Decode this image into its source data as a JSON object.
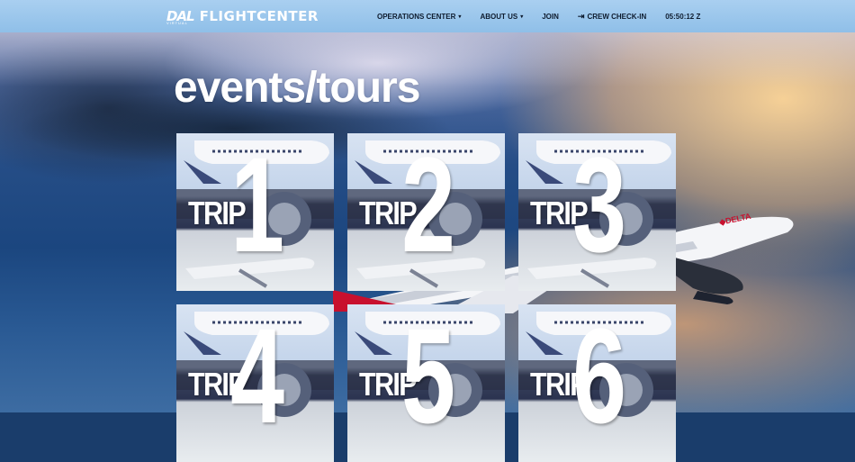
{
  "brand": {
    "mark": "DAL",
    "name": "FLIGHTCENTER",
    "sub": "VIRTUAL"
  },
  "nav": {
    "items": [
      {
        "label": "OPERATIONS CENTER",
        "dropdown": true,
        "icon": "chevron-down-icon"
      },
      {
        "label": "ABOUT US",
        "dropdown": true,
        "icon": "chevron-down-icon"
      },
      {
        "label": "JOIN",
        "dropdown": false
      },
      {
        "label": "CREW CHECK-IN",
        "dropdown": false,
        "icon": "sign-in-icon"
      },
      {
        "label": "05:50:12 Z",
        "dropdown": false
      }
    ]
  },
  "page": {
    "title": "events/tours"
  },
  "tours": [
    {
      "word": "TRIP",
      "number": "1"
    },
    {
      "word": "TRIP",
      "number": "2"
    },
    {
      "word": "TRIP",
      "number": "3"
    },
    {
      "word": "TRIP",
      "number": "4"
    },
    {
      "word": "TRIP",
      "number": "5"
    },
    {
      "word": "TRIP",
      "number": "6"
    }
  ],
  "colors": {
    "navbar": "#9fc8ee",
    "nav_text": "#0d1b2e",
    "delta_red": "#c8102e",
    "title": "#ffffff"
  }
}
